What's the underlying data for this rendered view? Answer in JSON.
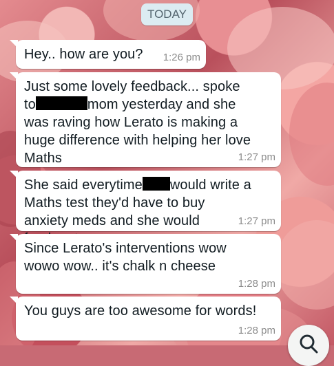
{
  "chat": {
    "date_label": "TODAY",
    "messages": [
      {
        "text": "Hey.. how are you?",
        "time": "1:26 pm"
      },
      {
        "line1": "Just some lovely feedback... spoke",
        "line2a": "to",
        "line2b": "mom yesterday and she",
        "rest": "was raving how Lerato is making a huge difference with helping her love Maths",
        "time": "1:27 pm"
      },
      {
        "line1a": "She said everytime",
        "line1b": "would write a",
        "rest": "Maths test they'd have to buy anxiety meds and she would freak out",
        "time": "1:27 pm"
      },
      {
        "text": "Since Lerato's interventions wow wowo wow.. it's chalk n cheese",
        "time": "1:28 pm"
      },
      {
        "text": "You guys are too awesome for words!",
        "time": "1:28 pm"
      }
    ]
  },
  "colors": {
    "bubble_bg": "#ffffff",
    "date_chip_bg": "#dcecf2",
    "time_color": "#8c8c8c"
  },
  "icons": {
    "fab": "search-icon"
  }
}
